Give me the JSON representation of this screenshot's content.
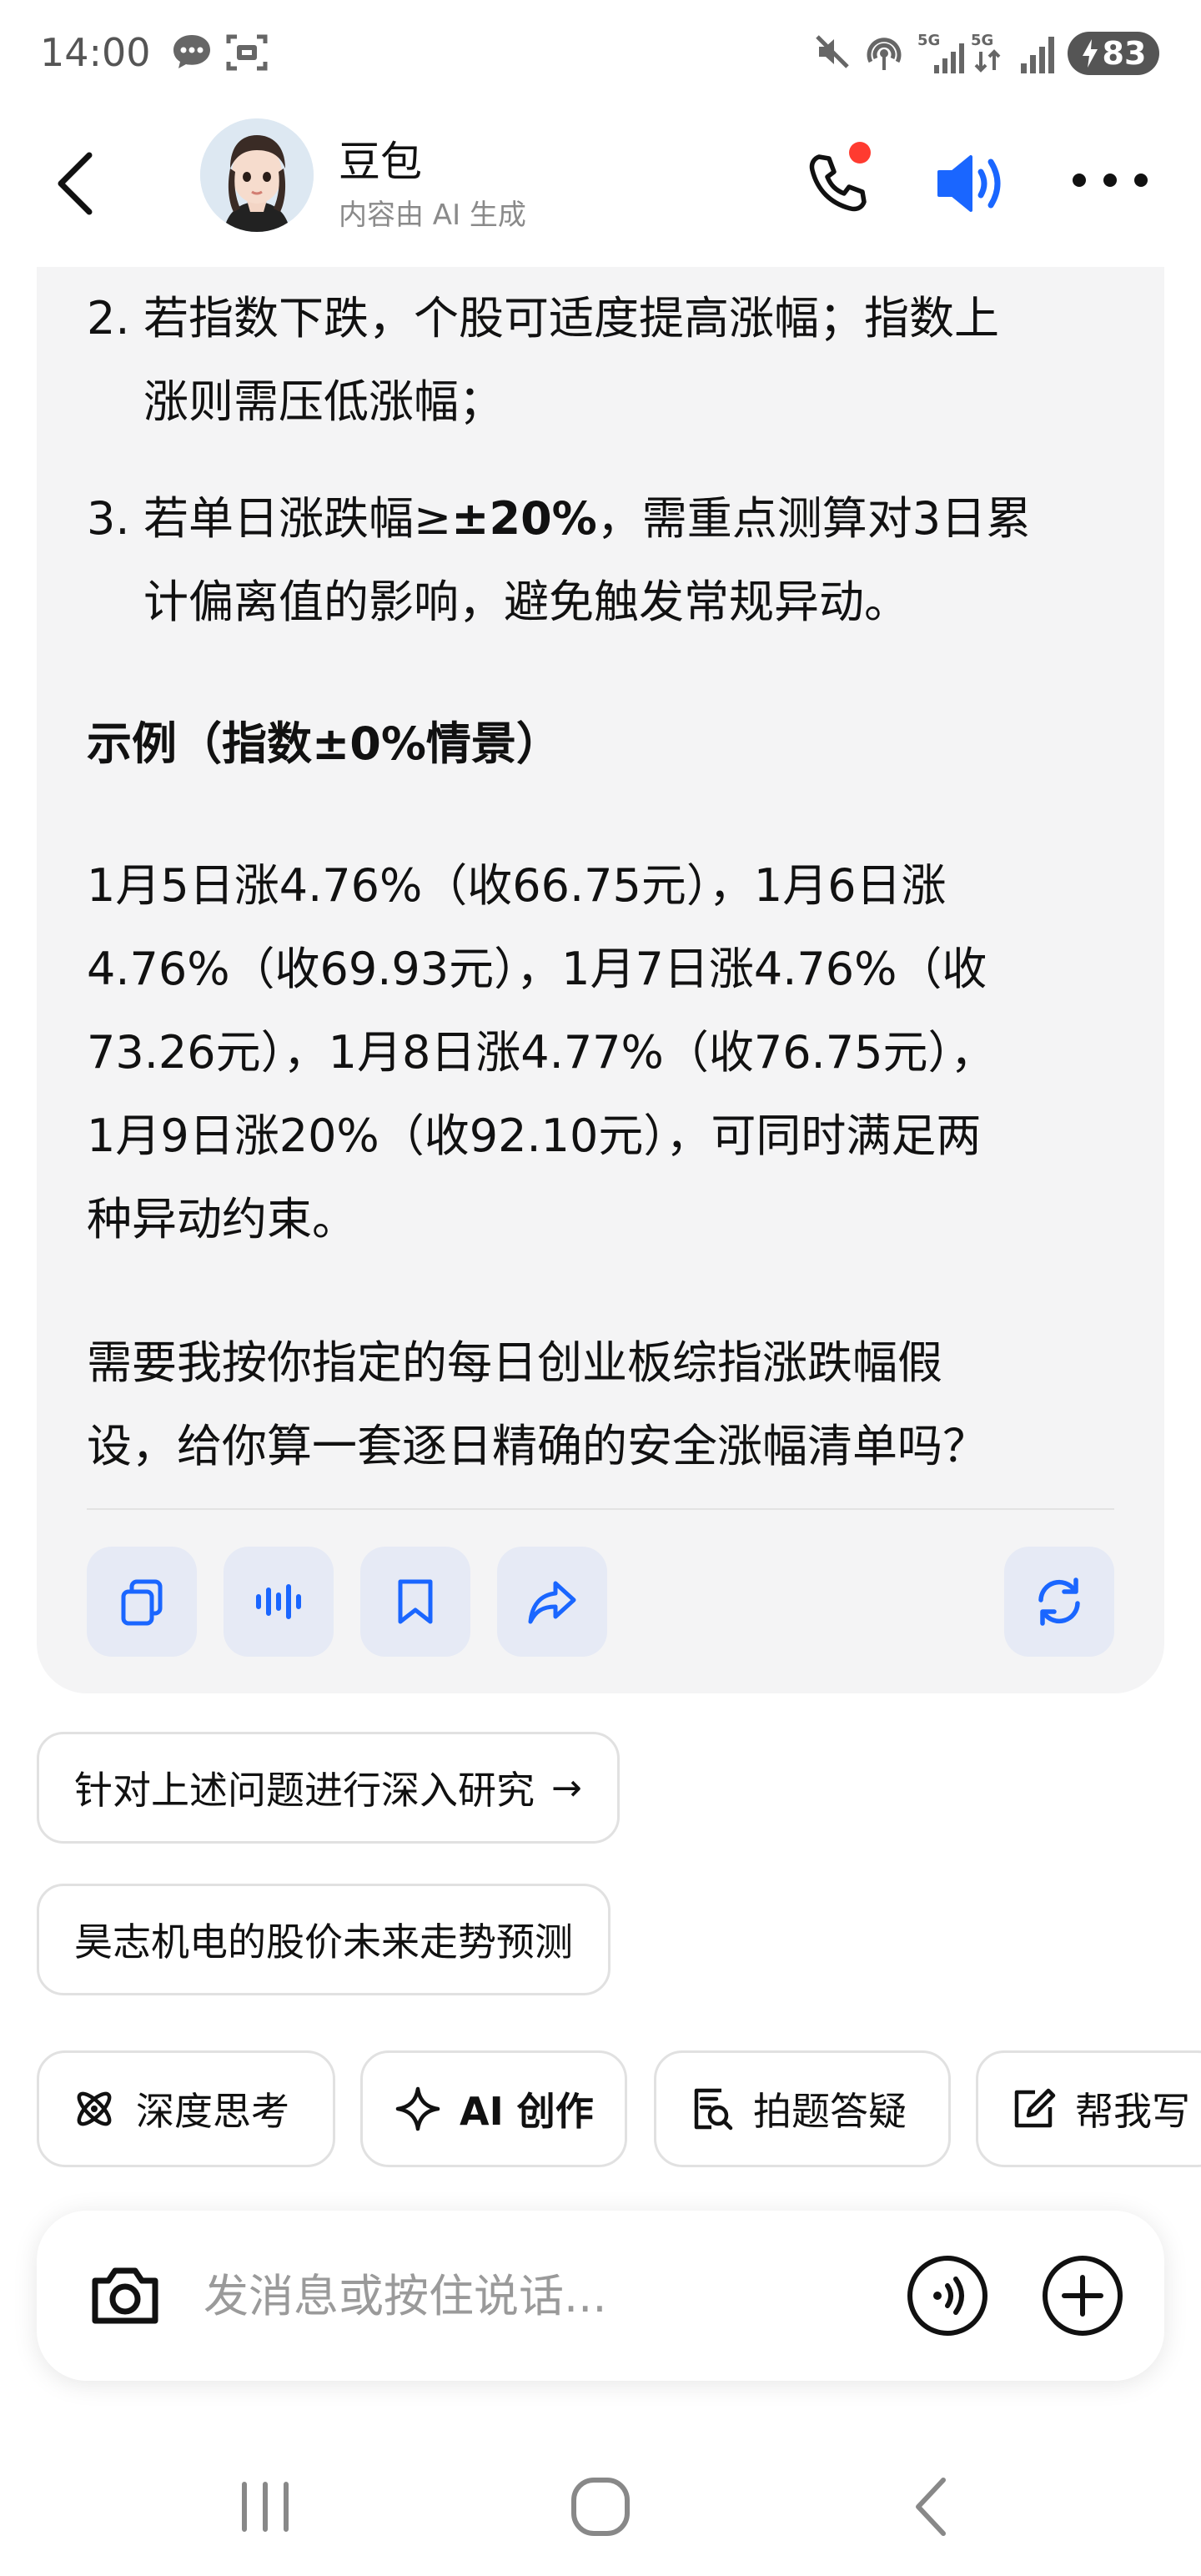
{
  "status_bar": {
    "time": "14:00",
    "icons": [
      "message-icon",
      "screenshot-icon",
      "mute-icon",
      "hotspot-icon",
      "signal-5g-icon",
      "signal-5g-data-icon",
      "signal-icon"
    ],
    "battery": "83"
  },
  "header": {
    "title": "豆包",
    "subtitle": "内容由 AI 生成",
    "accent_color": "#1a66ff",
    "notification_color": "#ff3b30"
  },
  "message": {
    "list": [
      {
        "num": "2.",
        "line1": "若指数下跌，个股可适度提高涨幅；指数上",
        "line2": "涨则需压低涨幅；"
      },
      {
        "num": "3.",
        "prefix": "若单日涨跌幅≥",
        "bold": "±20%",
        "suffix": "，需重点测算对3日累",
        "line2": "计偏离值的影响，避免触发常规异动。"
      }
    ],
    "example_heading": "示例（指数±0%情景）",
    "example_lines": [
      "1月5日涨4.76%（收66.75元），1月6日涨",
      "4.76%（收69.93元），1月7日涨4.76%（收",
      "73.26元），1月8日涨4.77%（收76.75元），",
      "1月9日涨20%（收92.10元），可同时满足两",
      "种异动约束。"
    ],
    "followup_lines": [
      "需要我按你指定的每日创业板综指涨跌幅假",
      "设，给你算一套逐日精确的安全涨幅清单吗？"
    ],
    "actions": [
      "copy-icon",
      "read-aloud-icon",
      "bookmark-icon",
      "share-icon",
      "regenerate-icon"
    ]
  },
  "suggestions": [
    {
      "label": "针对上述问题进行深入研究",
      "arrow": "→"
    },
    {
      "label": "昊志机电的股价未来走势预测"
    }
  ],
  "tools": [
    {
      "label": "深度思考",
      "icon": "atom-icon"
    },
    {
      "label": "AI 创作",
      "icon": "sparkle-icon"
    },
    {
      "label": "拍题答疑",
      "icon": "scan-question-icon"
    },
    {
      "label": "帮我写",
      "icon": "edit-icon"
    }
  ],
  "input": {
    "placeholder": "发消息或按住说话..."
  }
}
